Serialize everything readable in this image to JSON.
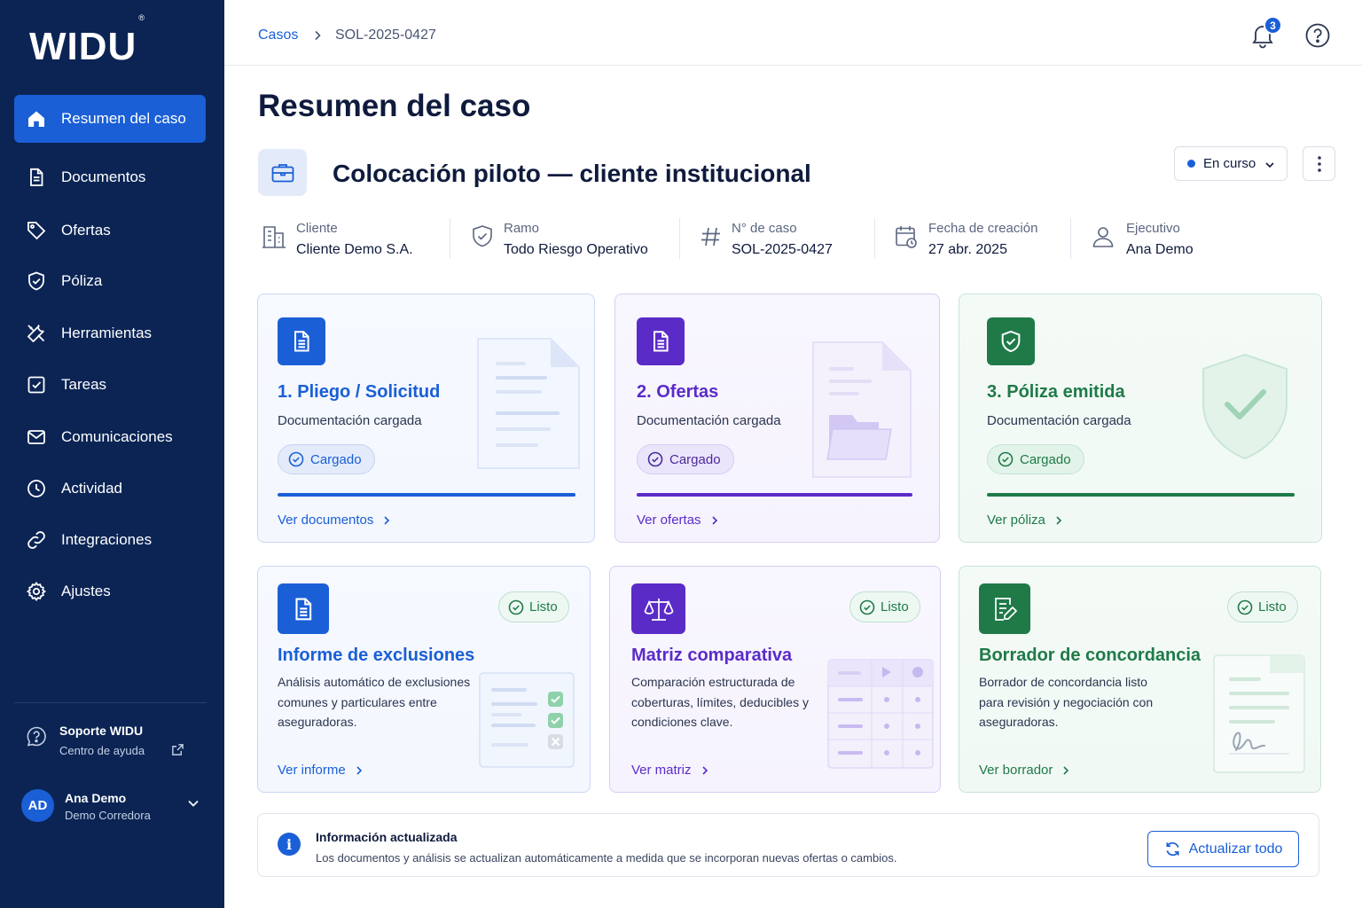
{
  "brand": {
    "logo": "WIDU",
    "reg": "®"
  },
  "sidebar": {
    "items": [
      {
        "label": "Resumen del caso",
        "icon": "home-icon"
      },
      {
        "label": "Documentos",
        "icon": "document-icon"
      },
      {
        "label": "Ofertas",
        "icon": "tag-icon"
      },
      {
        "label": "Póliza",
        "icon": "shield-icon"
      },
      {
        "label": "Herramientas",
        "icon": "tools-icon"
      },
      {
        "label": "Tareas",
        "icon": "checkbox-icon"
      },
      {
        "label": "Comunicaciones",
        "icon": "mail-icon"
      },
      {
        "label": "Actividad",
        "icon": "clock-icon"
      },
      {
        "label": "Integraciones",
        "icon": "link-icon"
      },
      {
        "label": "Ajustes",
        "icon": "gear-icon"
      }
    ],
    "support": {
      "title": "Soporte WIDU",
      "subtitle": "Centro de ayuda"
    },
    "user": {
      "initials": "AD",
      "name": "Ana Demo",
      "org": "Demo Corredora"
    }
  },
  "header": {
    "breadcrumb_root": "Casos",
    "breadcrumb_current": "SOL-2025-0427",
    "notifications_count": "3"
  },
  "page": {
    "title": "Resumen del caso",
    "case_title": "Colocación piloto — cliente institucional",
    "status": "En curso"
  },
  "meta": [
    {
      "label": "Cliente",
      "value": "Cliente Demo S.A.",
      "icon": "building-icon"
    },
    {
      "label": "Ramo",
      "value": "Todo Riesgo Operativo",
      "icon": "shield-icon"
    },
    {
      "label": "N° de caso",
      "value": "SOL-2025-0427",
      "icon": "hash-icon"
    },
    {
      "label": "Fecha de creación",
      "value": "27 abr. 2025",
      "icon": "calendar-icon"
    },
    {
      "label": "Ejecutivo",
      "value": "Ana Demo",
      "icon": "user-icon"
    }
  ],
  "stages": [
    {
      "title": "1. Pliego / Solicitud",
      "subtitle": "Documentación cargada",
      "status": "Cargado",
      "link": "Ver documentos",
      "color": "#1a5fd6"
    },
    {
      "title": "2. Ofertas",
      "subtitle": "Documentación cargada",
      "status": "Cargado",
      "link": "Ver ofertas",
      "color": "#5b2bc8"
    },
    {
      "title": "3. Póliza emitida",
      "subtitle": "Documentación cargada",
      "status": "Cargado",
      "link": "Ver póliza",
      "color": "#1f7a48"
    }
  ],
  "tools": [
    {
      "title": "Informe de exclusiones",
      "status": "Listo",
      "desc": [
        "Análisis automático de exclusiones",
        "comunes y particulares entre",
        "aseguradoras."
      ],
      "link": "Ver informe",
      "color": "#1a5fd6"
    },
    {
      "title": "Matriz comparativa",
      "status": "Listo",
      "desc": [
        "Comparación estructurada de",
        "coberturas, límites, deducibles y",
        "condiciones clave."
      ],
      "link": "Ver matriz",
      "color": "#5b2bc8"
    },
    {
      "title": "Borrador de concordancia",
      "status": "Listo",
      "desc": [
        "Borrador de concordancia listo",
        "para revisión y negociación con",
        "aseguradoras."
      ],
      "link": "Ver borrador",
      "color": "#1f7a48"
    }
  ],
  "banner": {
    "title": "Información actualizada",
    "text": "Los documentos y análisis se actualizan automáticamente a medida que se incorporan nuevas ofertas o cambios.",
    "button": "Actualizar todo"
  }
}
